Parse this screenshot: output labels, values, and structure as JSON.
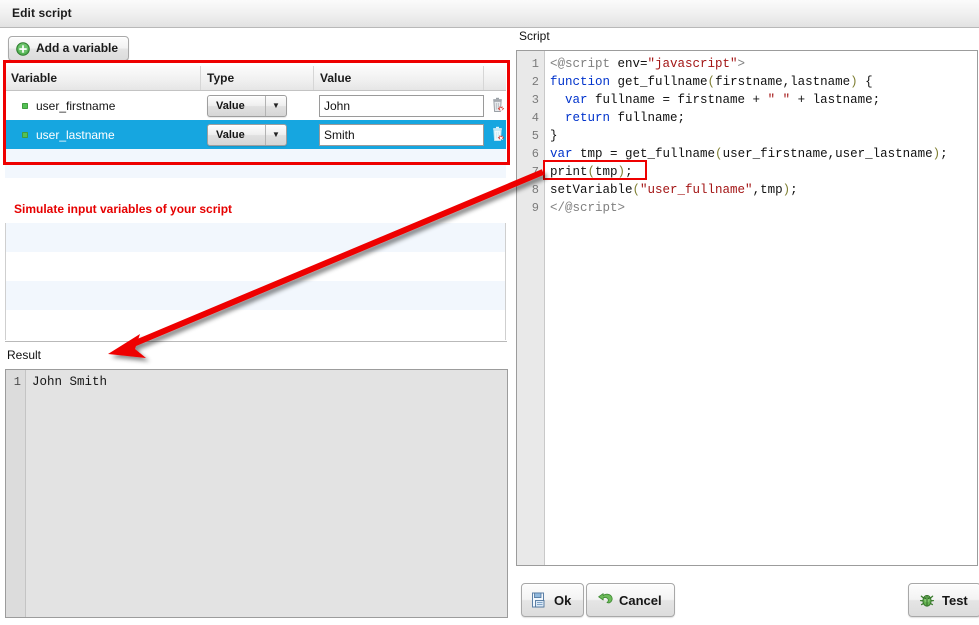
{
  "window": {
    "title": "Edit script"
  },
  "left": {
    "add_button": {
      "label": "Add a variable",
      "icon": "plus-circle-icon"
    },
    "table": {
      "headers": {
        "variable": "Variable",
        "type": "Type",
        "value": "Value",
        "actions": ""
      },
      "rows": [
        {
          "name": "user_firstname",
          "type": "Value",
          "value": "John",
          "selected": false,
          "delete_icon": "trash-delete-icon"
        },
        {
          "name": "user_lastname",
          "type": "Value",
          "value": "Smith",
          "selected": true,
          "delete_icon": "trash-delete-icon"
        }
      ],
      "empty_rows": 4
    },
    "hint": "Simulate input variables of your script",
    "result": {
      "label": "Result",
      "lines": [
        "John Smith"
      ],
      "line_numbers": [
        "1"
      ]
    }
  },
  "right": {
    "script_label": "Script",
    "editor": {
      "line_numbers": [
        "1",
        "2",
        "3",
        "4",
        "5",
        "6",
        "7",
        "8",
        "9"
      ],
      "lines": [
        [
          {
            "t": "<@script ",
            "c": "tag"
          },
          {
            "t": "env=",
            "c": "plain"
          },
          {
            "t": "\"javascript\"",
            "c": "str"
          },
          {
            "t": ">",
            "c": "tag"
          }
        ],
        [
          {
            "t": "function",
            "c": "kw"
          },
          {
            "t": " get_fullname",
            "c": "plain"
          },
          {
            "t": "(",
            "c": "pun"
          },
          {
            "t": "firstname,lastname",
            "c": "plain"
          },
          {
            "t": ")",
            "c": "pun"
          },
          {
            "t": " {",
            "c": "plain"
          }
        ],
        [
          {
            "t": "  ",
            "c": "plain"
          },
          {
            "t": "var",
            "c": "kw"
          },
          {
            "t": " fullname = firstname + ",
            "c": "plain"
          },
          {
            "t": "\" \"",
            "c": "str"
          },
          {
            "t": " + lastname;",
            "c": "plain"
          }
        ],
        [
          {
            "t": "  ",
            "c": "plain"
          },
          {
            "t": "return",
            "c": "kw"
          },
          {
            "t": " fullname;",
            "c": "plain"
          }
        ],
        [
          {
            "t": "}",
            "c": "plain"
          }
        ],
        [
          {
            "t": "var",
            "c": "kw"
          },
          {
            "t": " tmp = get_fullname",
            "c": "plain"
          },
          {
            "t": "(",
            "c": "pun"
          },
          {
            "t": "user_firstname,user_lastname",
            "c": "plain"
          },
          {
            "t": ")",
            "c": "pun"
          },
          {
            "t": ";",
            "c": "plain"
          }
        ],
        [
          {
            "t": "print",
            "c": "plain"
          },
          {
            "t": "(",
            "c": "pun"
          },
          {
            "t": "tmp",
            "c": "plain"
          },
          {
            "t": ")",
            "c": "pun"
          },
          {
            "t": ";",
            "c": "plain"
          }
        ],
        [
          {
            "t": "setVariable",
            "c": "plain"
          },
          {
            "t": "(",
            "c": "pun"
          },
          {
            "t": "\"user_fullname\"",
            "c": "str"
          },
          {
            "t": ",tmp",
            "c": "plain"
          },
          {
            "t": ")",
            "c": "pun"
          },
          {
            "t": ";",
            "c": "plain"
          }
        ],
        [
          {
            "t": "</@script>",
            "c": "tag"
          }
        ]
      ],
      "plain_text": "<@script env=\"javascript\">\nfunction get_fullname(firstname,lastname) {\n  var fullname = firstname + \" \" + lastname;\n  return fullname;\n}\nvar tmp = get_fullname(user_firstname,user_lastname);\nprint(tmp);\nsetVariable(\"user_fullname\",tmp);\n</@script>"
    },
    "buttons": {
      "ok": {
        "label": "Ok",
        "icon": "save-disk-icon"
      },
      "cancel": {
        "label": "Cancel",
        "icon": "undo-arrow-icon"
      },
      "test": {
        "label": "Test",
        "icon": "bug-icon"
      }
    }
  },
  "annotations": {
    "color": "#ee0000",
    "variables_highlight": "variables table highlighted",
    "print_highlight": "print(tmp); highlighted",
    "arrow": "arrow from print(tmp) to result output John Smith"
  },
  "colors": {
    "annotation_red": "#ee0000",
    "hint_red": "#e60000",
    "selection_blue": "#16a6e0",
    "stripe_blue": "#f2f7fd",
    "keyword_blue": "#0033cc",
    "string_red": "#a31515",
    "tag_gray": "#808080",
    "punct_olive": "#7f7f33"
  }
}
